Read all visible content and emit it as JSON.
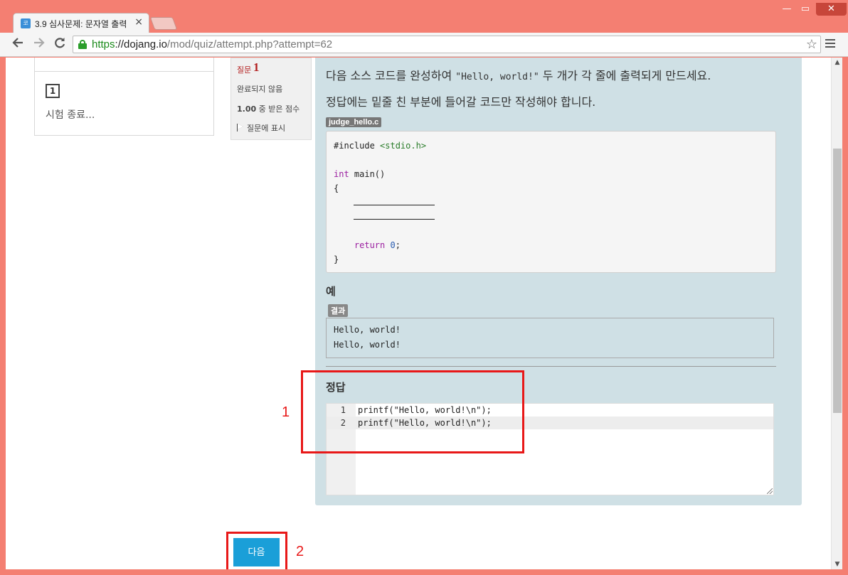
{
  "browser": {
    "tab_title": "3.9 심사문제: 문자열 출력",
    "tab_close": "×",
    "favicon": "코",
    "url_scheme": "https",
    "url_host": "://dojang.io",
    "url_path": "/mod/quiz/attempt.php?attempt=62",
    "window_controls": {
      "minimize": "—",
      "maximize": "▭",
      "close": "✕"
    },
    "icons": {
      "back": "arrow-left",
      "forward": "arrow-right",
      "reload": "reload",
      "star": "star",
      "menu": "hamburger"
    }
  },
  "quiz_nav": {
    "question_number": "1",
    "finish_link": "시험 종료..."
  },
  "question_info": {
    "label": "질문",
    "number": "1",
    "state": "완료되지 않음",
    "grade_value": "1.00",
    "grade_text": " 중 받은 점수",
    "flag_text": "질문에 표시"
  },
  "question": {
    "prompt_before": "다음 소스 코드를 완성하여 ",
    "prompt_code": "\"Hello, world!\"",
    "prompt_after": " 두 개가 각 줄에 출력되게 만드세요.",
    "prompt_line2": "정답에는 밑줄 친 부분에 들어갈 코드만 작성해야 합니다.",
    "file_name": "judge_hello.c",
    "code": {
      "include_kw": "#include",
      "include_header": " <stdio.h>",
      "int_kw": "int",
      "main_fn": " main()",
      "open_brace": "{",
      "return_kw": "    return",
      "return_value": " 0",
      "semicolon": ";",
      "close_brace": "}"
    },
    "example_heading": "예",
    "result_label": "결과",
    "result_lines": [
      "Hello, world!",
      "Hello, world!"
    ],
    "answer_heading": "정답",
    "answer_lines": [
      {
        "no": "1",
        "code": "printf(\"Hello, world!\\n\");"
      },
      {
        "no": "2",
        "code": "printf(\"Hello, world!\\n\");"
      }
    ]
  },
  "next_button_label": "다음",
  "annotations": {
    "first": "1",
    "second": "2"
  },
  "colors": {
    "window_frame": "#f47f72",
    "accent": "#1a9fd8",
    "annotation": "#e81818",
    "panel": "#cfe0e5"
  }
}
